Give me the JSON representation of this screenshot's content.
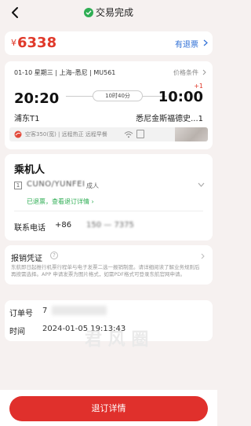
{
  "header": {
    "title": "交易完成"
  },
  "price": {
    "currency": "¥",
    "amount": "6338",
    "refund_label": "有退票"
  },
  "flight": {
    "meta": "01-10 星期三 | 上海–悉尼 | MU561",
    "price_conditions": "价格条件",
    "departure_time": "20:20",
    "arrival_time": "10:00",
    "day_offset": "+1",
    "duration": "10时40分",
    "departure_airport": "浦东T1",
    "arrival_airport": "悉尼金斯福德史...1",
    "bar_text": "空客350(宽) | 远程热正 远程早餐"
  },
  "passenger": {
    "section_title": "乘机人",
    "id_box": "1",
    "name": "CUNO/YUNFEI",
    "type": "成人",
    "ticket_status": "已退票，查看退订详情 ›",
    "phone_label": "联系电话",
    "phone_country_code": "+86",
    "phone_number": "150 — 7375"
  },
  "receipt": {
    "title": "报销凭证",
    "help_glyph": "?",
    "description": "东航即日起推行机票行程单与电子发票二选一报销制度。请详细阅读了解业务规则后再按需选择。APP 申请发票为图片格式，如需PDF格式可登录东航官网申请。"
  },
  "order": {
    "order_label": "订单号",
    "order_number": "7",
    "time_label": "时间",
    "time_value": "2024-01-05 19:13:43"
  },
  "watermark": "君 风 圈",
  "footer": {
    "detail_button": "退订详情"
  },
  "colors": {
    "accent": "#e0302c",
    "success": "#2fae54",
    "link": "#2f6fd6",
    "background": "#f6f1f0"
  }
}
